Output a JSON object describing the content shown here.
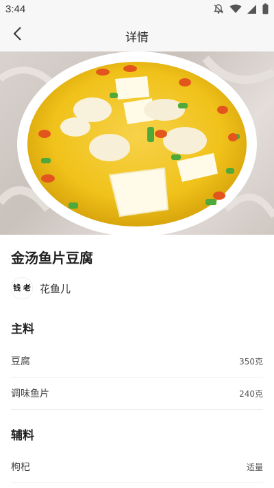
{
  "status_bar": {
    "time": "3:44"
  },
  "header": {
    "title": "详情"
  },
  "hero": {
    "slide_count": 2,
    "active_slide": 1
  },
  "recipe": {
    "title": "金汤鱼片豆腐",
    "author": {
      "name": "花鱼儿",
      "avatar_text": "钱 老"
    }
  },
  "main_ingredients": {
    "title": "主料",
    "items": [
      {
        "name": "豆腐",
        "qty": "350克"
      },
      {
        "name": "调味鱼片",
        "qty": "240克"
      }
    ]
  },
  "secondary_ingredients": {
    "title": "辅料",
    "items": [
      {
        "name": "枸杞",
        "qty": "适量"
      }
    ]
  },
  "colors": {
    "soup": "#f0c21a",
    "tofu": "#fffbe8",
    "accent": "#333333"
  }
}
